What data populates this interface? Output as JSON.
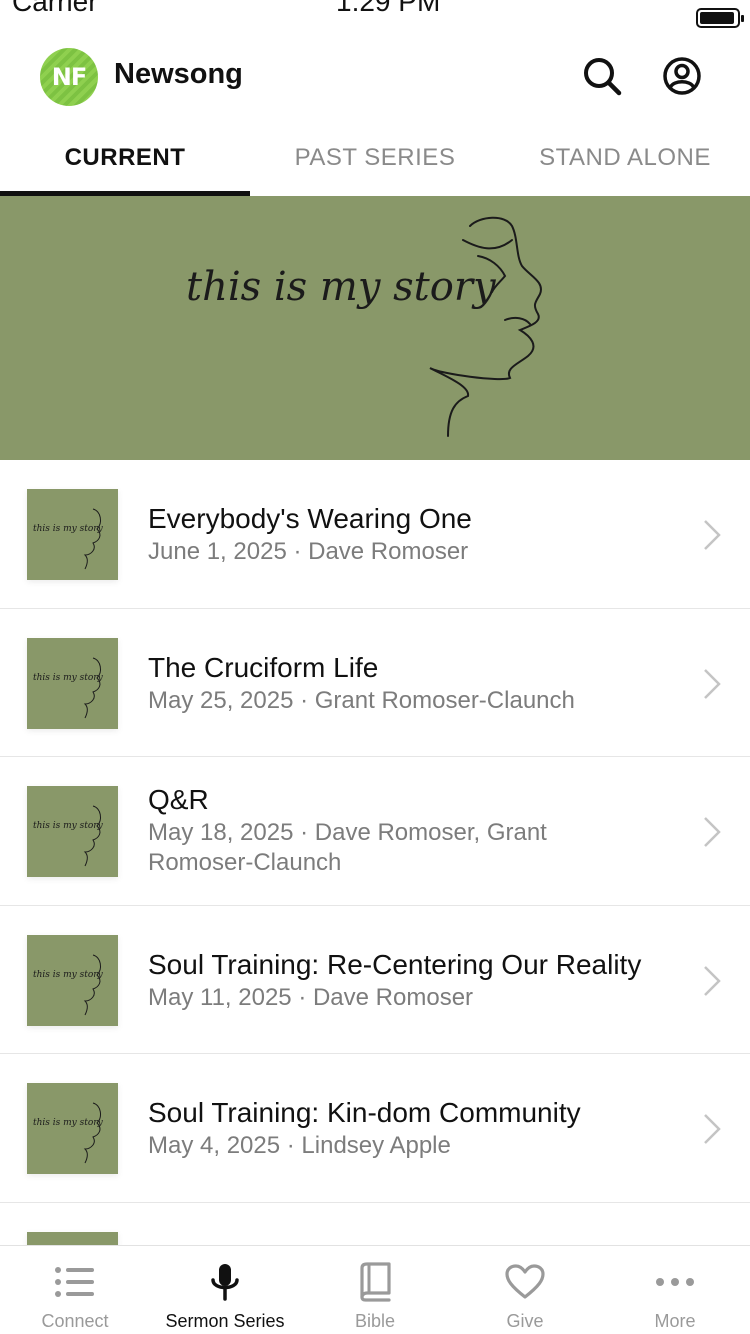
{
  "status_bar": {
    "carrier": "Carrier",
    "time": "1:29 PM",
    "battery_level": 0.95
  },
  "header": {
    "logo_text": "NF",
    "title": "Newsong"
  },
  "tabs": [
    {
      "label": "CURRENT",
      "active": true
    },
    {
      "label": "PAST SERIES",
      "active": false
    },
    {
      "label": "STAND ALONE",
      "active": false
    }
  ],
  "banner": {
    "artwork_text": "this is my story",
    "background": "#899869"
  },
  "sermons": [
    {
      "title": "Everybody's Wearing One",
      "subtitle": "June 1, 2025 · Dave Romoser"
    },
    {
      "title": "The Cruciform Life",
      "subtitle": "May 25, 2025 · Grant Romoser-Claunch"
    },
    {
      "title": "Q&R",
      "subtitle": "May 18, 2025 · Dave Romoser, Grant Romoser-Claunch"
    },
    {
      "title": "Soul Training: Re-Centering Our Reality",
      "subtitle": "May 11, 2025 · Dave Romoser"
    },
    {
      "title": "Soul Training: Kin-dom Community",
      "subtitle": "May 4, 2025 · Lindsey Apple"
    }
  ],
  "tabbar": [
    {
      "label": "Connect",
      "icon": "list-icon",
      "active": false
    },
    {
      "label": "Sermon Series",
      "icon": "microphone-icon",
      "active": true
    },
    {
      "label": "Bible",
      "icon": "book-icon",
      "active": false
    },
    {
      "label": "Give",
      "icon": "heart-icon",
      "active": false
    },
    {
      "label": "More",
      "icon": "more-dots-icon",
      "active": false
    }
  ],
  "colors": {
    "accent": "#7dc242",
    "artwork_green": "#899869",
    "inactive": "#9a9a9a"
  }
}
